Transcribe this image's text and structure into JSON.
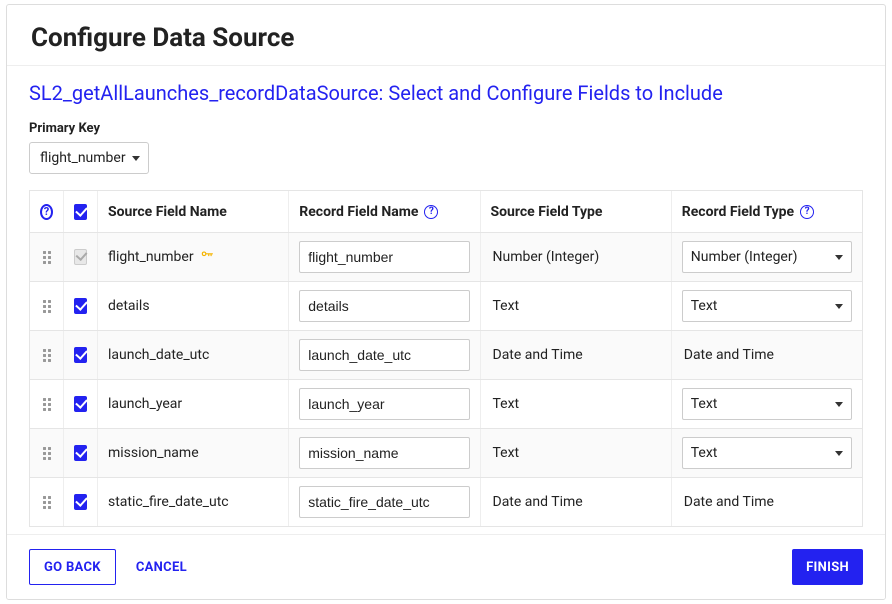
{
  "header": {
    "title": "Configure Data Source"
  },
  "section": {
    "title": "SL2_getAllLaunches_recordDataSource: Select and Configure Fields to Include"
  },
  "primaryKey": {
    "label": "Primary Key",
    "value": "flight_number"
  },
  "columns": {
    "sourceFieldName": "Source Field Name",
    "recordFieldName": "Record Field Name",
    "sourceFieldType": "Source Field Type",
    "recordFieldType": "Record Field Type"
  },
  "rows": [
    {
      "checked": true,
      "locked": true,
      "sourceName": "flight_number",
      "isKey": true,
      "recordName": "flight_number",
      "sourceType": "Number (Integer)",
      "recordType": "Number (Integer)",
      "recordTypeEditable": true
    },
    {
      "checked": true,
      "locked": false,
      "sourceName": "details",
      "isKey": false,
      "recordName": "details",
      "sourceType": "Text",
      "recordType": "Text",
      "recordTypeEditable": true
    },
    {
      "checked": true,
      "locked": false,
      "sourceName": "launch_date_utc",
      "isKey": false,
      "recordName": "launch_date_utc",
      "sourceType": "Date and Time",
      "recordType": "Date and Time",
      "recordTypeEditable": false
    },
    {
      "checked": true,
      "locked": false,
      "sourceName": "launch_year",
      "isKey": false,
      "recordName": "launch_year",
      "sourceType": "Text",
      "recordType": "Text",
      "recordTypeEditable": true
    },
    {
      "checked": true,
      "locked": false,
      "sourceName": "mission_name",
      "isKey": false,
      "recordName": "mission_name",
      "sourceType": "Text",
      "recordType": "Text",
      "recordTypeEditable": true
    },
    {
      "checked": true,
      "locked": false,
      "sourceName": "static_fire_date_utc",
      "isKey": false,
      "recordName": "static_fire_date_utc",
      "sourceType": "Date and Time",
      "recordType": "Date and Time",
      "recordTypeEditable": false
    }
  ],
  "footer": {
    "goBack": "Go Back",
    "cancel": "Cancel",
    "finish": "Finish"
  }
}
